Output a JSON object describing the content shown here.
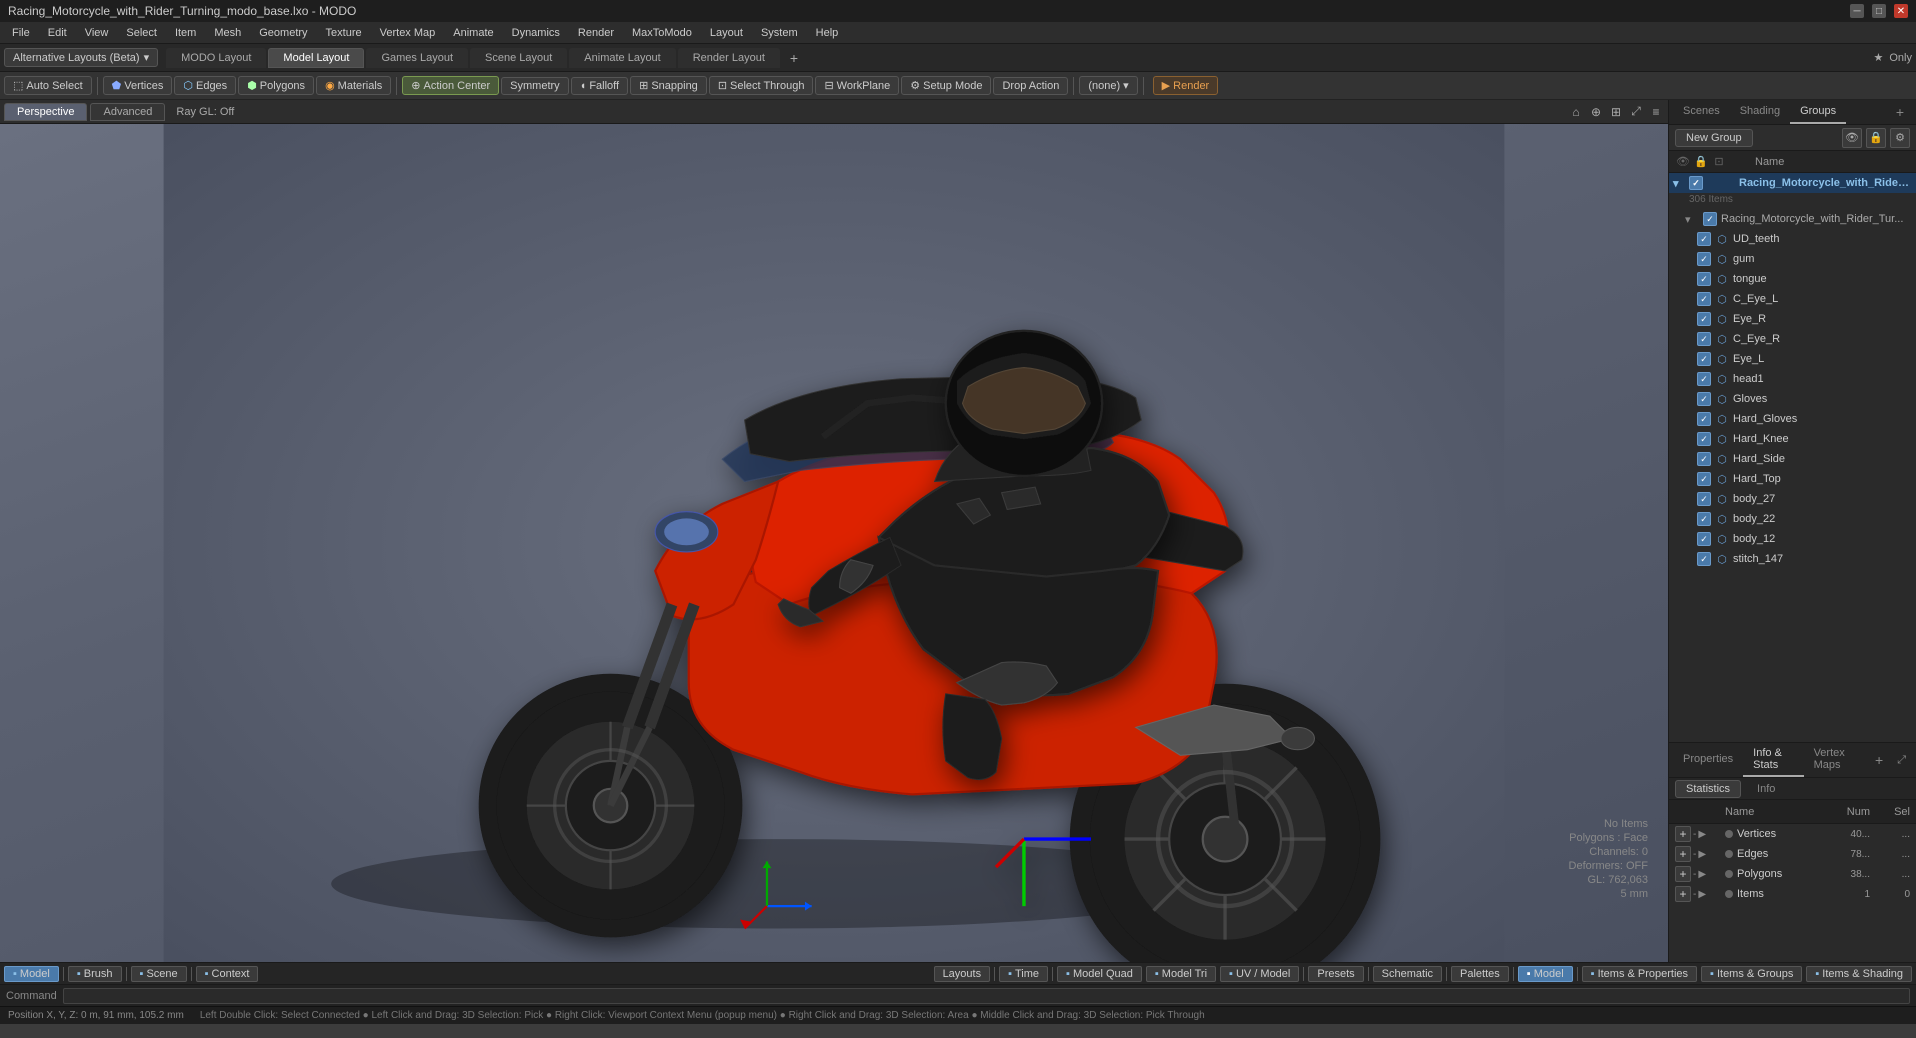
{
  "window": {
    "title": "Racing_Motorcycle_with_Rider_Turning_modo_base.lxo - MODO"
  },
  "menu": {
    "items": [
      "File",
      "Edit",
      "View",
      "Select",
      "Item",
      "Mesh",
      "Geometry",
      "Texture",
      "Vertex Map",
      "Animate",
      "Dynamics",
      "Render",
      "MaxToModo",
      "Layout",
      "System",
      "Help"
    ]
  },
  "layouts": {
    "alt_layouts_label": "Alternative Layouts (Beta)",
    "tabs": [
      "MODO Layout",
      "Model Layout",
      "Games Layout",
      "Scene Layout",
      "Animate Layout",
      "Render Layout"
    ],
    "active": "Model Layout",
    "add_btn": "+",
    "star_label": "★  Only"
  },
  "toolbar": {
    "auto_select": "Auto Select",
    "vertices": "Vertices",
    "edges": "Edges",
    "polygons": "Polygons",
    "materials": "Materials",
    "action_center": "Action Center",
    "symmetry": "Symmetry",
    "falloff": "Falloff",
    "snapping": "Snapping",
    "select_through": "Select Through",
    "workplane": "WorkPlane",
    "setup_mode": "Setup Mode",
    "drop_action": "Drop Action",
    "none_label": "(none)",
    "render": "Render"
  },
  "viewport": {
    "tabs": [
      "Perspective",
      "Advanced"
    ],
    "ray_gl": "Ray GL: Off",
    "icons": [
      "⟲",
      "⟳",
      "⊕",
      "⊞",
      "◱"
    ]
  },
  "viewport_info": {
    "no_items": "No Items",
    "polygons_face": "Polygons : Face",
    "channels_0": "Channels: 0",
    "deformers_off": "Deformers: OFF",
    "gl_count": "GL: 762,063",
    "unit": "5 mm"
  },
  "right_panel": {
    "tabs": [
      "Scenes",
      "Shading",
      "Groups"
    ],
    "active_tab": "Groups",
    "add_btn": "+",
    "new_group_btn": "New Group",
    "list_header": "Name",
    "groups": [
      {
        "id": "root",
        "name": "Racing_Motorcycle_with_Rider_...",
        "count": "306 Items",
        "level": 0,
        "is_main": true,
        "expanded": true
      },
      {
        "id": "sub1",
        "name": "Racing_Motorcycle_with_Rider_Tur...",
        "level": 1,
        "is_sub": true
      },
      {
        "id": "ud_teeth",
        "name": "UD_teeth",
        "level": 2,
        "checked": true
      },
      {
        "id": "gum",
        "name": "gum",
        "level": 2,
        "checked": true
      },
      {
        "id": "tongue",
        "name": "tongue",
        "level": 2,
        "checked": true
      },
      {
        "id": "c_eye_l",
        "name": "C_Eye_L",
        "level": 2,
        "checked": true
      },
      {
        "id": "eye_r",
        "name": "Eye_R",
        "level": 2,
        "checked": true
      },
      {
        "id": "c_eye_r",
        "name": "C_Eye_R",
        "level": 2,
        "checked": true
      },
      {
        "id": "eye_l",
        "name": "Eye_L",
        "level": 2,
        "checked": true
      },
      {
        "id": "head1",
        "name": "head1",
        "level": 2,
        "checked": true
      },
      {
        "id": "gloves",
        "name": "Gloves",
        "level": 2,
        "checked": true
      },
      {
        "id": "hard_gloves",
        "name": "Hard_Gloves",
        "level": 2,
        "checked": true
      },
      {
        "id": "hard_knee",
        "name": "Hard_Knee",
        "level": 2,
        "checked": true
      },
      {
        "id": "hard_side",
        "name": "Hard_Side",
        "level": 2,
        "checked": true
      },
      {
        "id": "hard_top",
        "name": "Hard_Top",
        "level": 2,
        "checked": true
      },
      {
        "id": "body_27",
        "name": "body_27",
        "level": 2,
        "checked": true
      },
      {
        "id": "body_22",
        "name": "body_22",
        "level": 2,
        "checked": true
      },
      {
        "id": "body_12",
        "name": "body_12",
        "level": 2,
        "checked": true
      },
      {
        "id": "stitch_147",
        "name": "stitch_147",
        "level": 2,
        "checked": true
      }
    ]
  },
  "bottom_section": {
    "properties_tab": "Properties",
    "info_stats_tab": "Info & Stats",
    "vertex_maps_tab": "Vertex Maps",
    "active_tab": "Info & Stats",
    "info_tab": "Info",
    "stats_title": "Statistics",
    "stats_columns": {
      "name": "Name",
      "num": "Num",
      "sel": "Sel"
    },
    "stats_rows": [
      {
        "name": "Vertices",
        "num": "40...",
        "sel": "..."
      },
      {
        "name": "Edges",
        "num": "78...",
        "sel": "..."
      },
      {
        "name": "Polygons",
        "num": "38...",
        "sel": "..."
      },
      {
        "name": "Items",
        "num": "1",
        "sel": "0"
      }
    ]
  },
  "bottom_tabs": {
    "model_label": "▪ Model",
    "brush_label": "▪ Brush",
    "scene_label": "▪ Scene",
    "context_label": "▪ Context",
    "layouts_label": "Layouts",
    "time_label": "▪ Time",
    "model_quad": "▪ Model Quad",
    "model_tri": "▪ Model Tri",
    "uv_model": "▪ UV / Model",
    "presets": "Presets",
    "schematic": "Schematic",
    "palettes": "Palettes",
    "model_active": "▪ Model",
    "items_props": "▪ Items & Properties",
    "items_groups": "▪ Items & Groups",
    "items_shading": "▪ Items & Shading"
  },
  "command_bar": {
    "label": "Command",
    "placeholder": ""
  },
  "position_bar": {
    "position": "Position X, Y, Z:  0 m, 91 mm, 105.2 mm",
    "hints": "Left Double Click: Select Connected ● Left Click and Drag: 3D Selection: Pick ● Right Click: Viewport Context Menu (popup menu) ● Right Click and Drag: 3D Selection: Area ● Middle Click and Drag: 3D Selection: Pick Through"
  }
}
